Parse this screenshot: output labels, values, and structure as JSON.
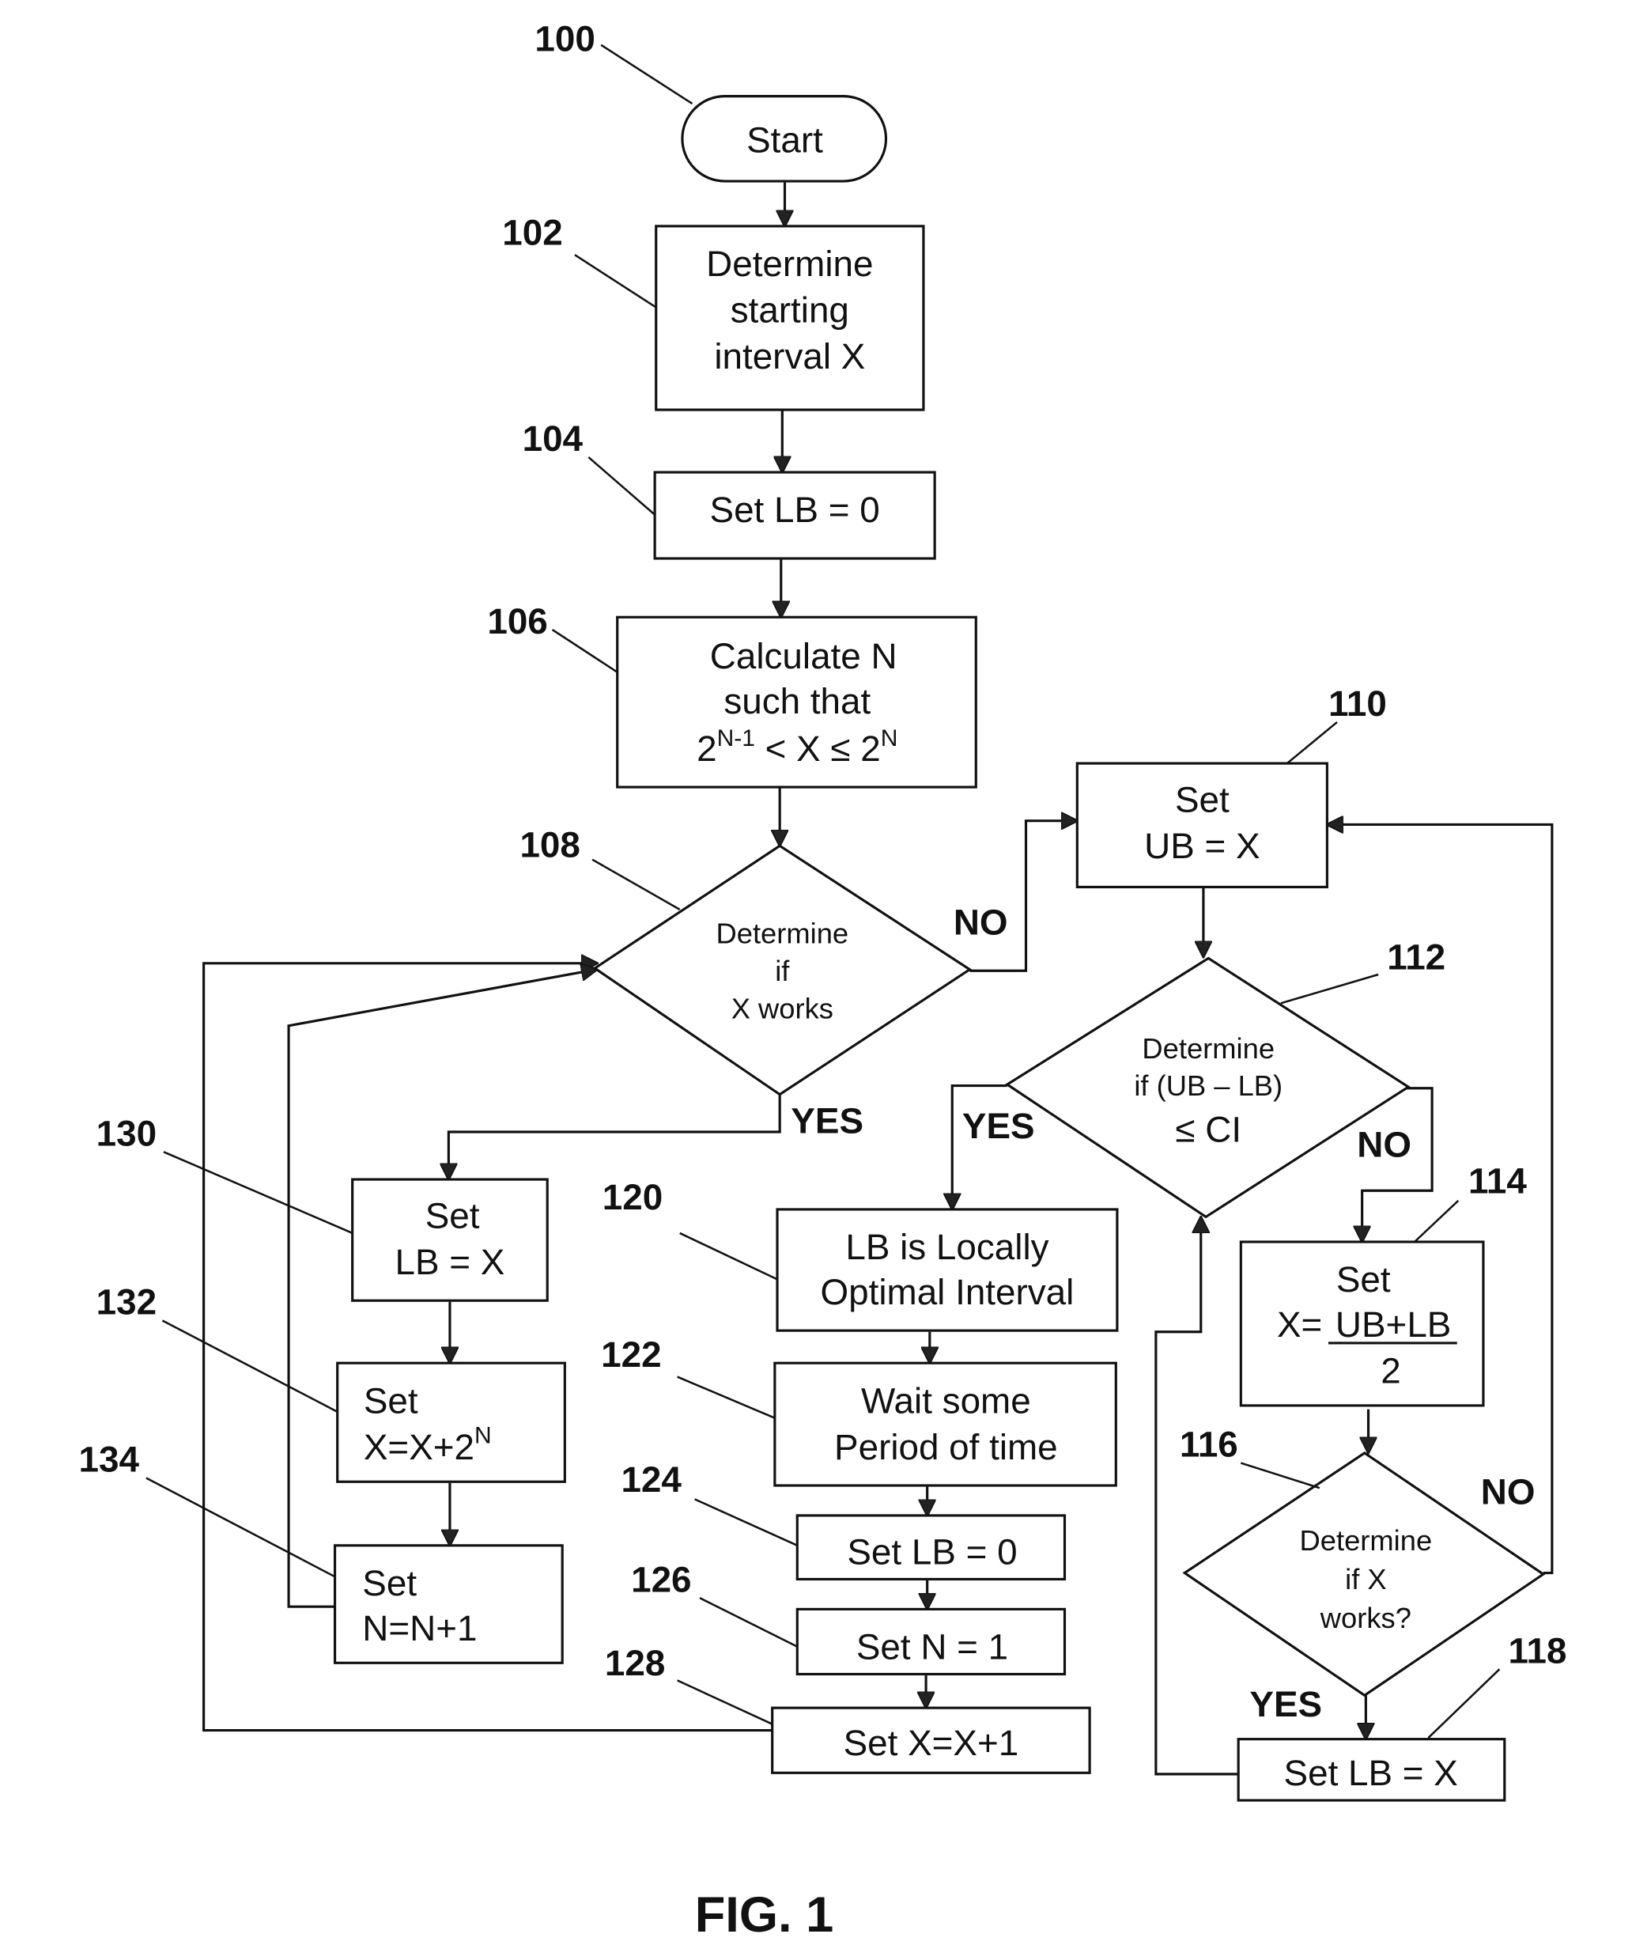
{
  "figure_label": "FIG. 1",
  "nodes": {
    "n100": {
      "ref": "100",
      "shape": "terminator",
      "lines": [
        "Start"
      ]
    },
    "n102": {
      "ref": "102",
      "shape": "process",
      "lines": [
        "Determine",
        "starting",
        "interval X"
      ]
    },
    "n104": {
      "ref": "104",
      "shape": "process",
      "lines": [
        "Set LB = 0"
      ]
    },
    "n106": {
      "ref": "106",
      "shape": "process",
      "lines": [
        "Calculate N",
        "such that",
        "2^(N-1) < X ≤ 2^N"
      ]
    },
    "n108": {
      "ref": "108",
      "shape": "decision",
      "lines": [
        "Determine",
        "if",
        "X works"
      ]
    },
    "n110": {
      "ref": "110",
      "shape": "process",
      "lines": [
        "Set",
        "UB = X"
      ]
    },
    "n112": {
      "ref": "112",
      "shape": "decision",
      "lines": [
        "Determine",
        "if (UB – LB)",
        "≤ CI"
      ]
    },
    "n114": {
      "ref": "114",
      "shape": "process",
      "lines": [
        "Set",
        "X= (UB+LB) / 2"
      ]
    },
    "n116": {
      "ref": "116",
      "shape": "decision",
      "lines": [
        "Determine",
        "if X",
        "works?"
      ]
    },
    "n118": {
      "ref": "118",
      "shape": "process",
      "lines": [
        "Set LB = X"
      ]
    },
    "n120": {
      "ref": "120",
      "shape": "process",
      "lines": [
        "LB is Locally",
        "Optimal Interval"
      ]
    },
    "n122": {
      "ref": "122",
      "shape": "process",
      "lines": [
        "Wait some",
        "Period of time"
      ]
    },
    "n124": {
      "ref": "124",
      "shape": "process",
      "lines": [
        "Set LB = 0"
      ]
    },
    "n126": {
      "ref": "126",
      "shape": "process",
      "lines": [
        "Set N = 1"
      ]
    },
    "n128": {
      "ref": "128",
      "shape": "process",
      "lines": [
        "Set X=X+1"
      ]
    },
    "n130": {
      "ref": "130",
      "shape": "process",
      "lines": [
        "Set",
        "LB = X"
      ]
    },
    "n132": {
      "ref": "132",
      "shape": "process",
      "lines": [
        "Set",
        "X=X+2^N"
      ]
    },
    "n134": {
      "ref": "134",
      "shape": "process",
      "lines": [
        "Set",
        "N=N+1"
      ]
    }
  },
  "text": {
    "n106_l1": "Calculate N",
    "n106_l2": "such that",
    "n106_base1": "2",
    "n106_exp1": "N-1",
    "n106_mid": " < X ≤ 2",
    "n106_exp2": "N",
    "n114_l1": "Set",
    "n114_pre": "X=",
    "n114_num": "UB+LB",
    "n114_den": "2",
    "n132_l1": "Set",
    "n132_base": "X=X+2",
    "n132_exp": "N"
  },
  "edge_labels": {
    "n108_no": "NO",
    "n108_yes": "YES",
    "n112_yes": "YES",
    "n112_no": "NO",
    "n116_no": "NO",
    "n116_yes": "YES"
  },
  "edges": [
    {
      "from": "100",
      "to": "102"
    },
    {
      "from": "102",
      "to": "104"
    },
    {
      "from": "104",
      "to": "106"
    },
    {
      "from": "106",
      "to": "108"
    },
    {
      "from": "108",
      "to": "110",
      "label": "NO"
    },
    {
      "from": "108",
      "to": "130",
      "label": "YES"
    },
    {
      "from": "110",
      "to": "112"
    },
    {
      "from": "112",
      "to": "120",
      "label": "YES"
    },
    {
      "from": "112",
      "to": "114",
      "label": "NO"
    },
    {
      "from": "114",
      "to": "116"
    },
    {
      "from": "116",
      "to": "118",
      "label": "YES"
    },
    {
      "from": "116",
      "to": "110",
      "label": "NO"
    },
    {
      "from": "118",
      "to": "112"
    },
    {
      "from": "120",
      "to": "122"
    },
    {
      "from": "122",
      "to": "124"
    },
    {
      "from": "124",
      "to": "126"
    },
    {
      "from": "126",
      "to": "128"
    },
    {
      "from": "128",
      "to": "108"
    },
    {
      "from": "130",
      "to": "132"
    },
    {
      "from": "132",
      "to": "134"
    },
    {
      "from": "134",
      "to": "108"
    }
  ]
}
